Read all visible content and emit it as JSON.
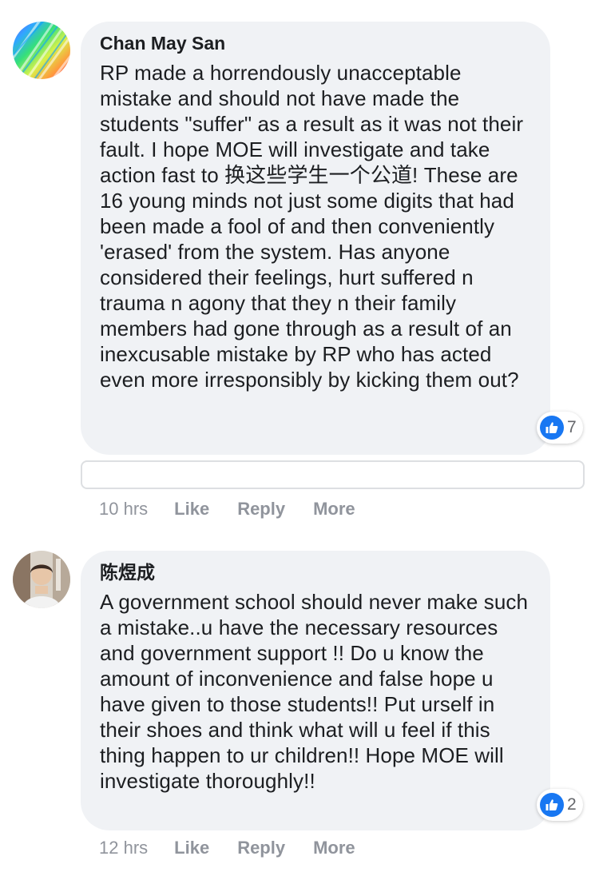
{
  "comments": [
    {
      "author": "Chan May San",
      "text": "RP made a horrendously unacceptable mistake and should not have made the students \"suffer\" as a result as it was not their fault. I hope MOE will investigate and take action fast to 换这些学生一个公道! These are 16 young minds not just some digits that had been made a fool of and then conveniently 'erased' from the system. Has anyone considered their feelings, hurt suffered n trauma n agony that they n their family members had gone through as a result of an inexcusable mistake by RP who has acted even more irresponsibly by kicking them out?",
      "reaction_count": "7",
      "time": "10 hrs",
      "like_label": "Like",
      "reply_label": "Reply",
      "more_label": "More"
    },
    {
      "author": "陈煜成",
      "text": "A government school should never make such a mistake..u have the necessary resources and government support !! Do u know the amount of inconvenience and false hope u have given to those students!! Put urself in their shoes and think what will u feel if this thing happen to ur children!! Hope MOE will investigate thoroughly!!",
      "reaction_count": "2",
      "time": "12 hrs",
      "like_label": "Like",
      "reply_label": "Reply",
      "more_label": "More"
    }
  ],
  "colors": {
    "bubble": "#f0f2f5",
    "like_blue": "#1877f2",
    "meta_gray": "#90949c"
  }
}
